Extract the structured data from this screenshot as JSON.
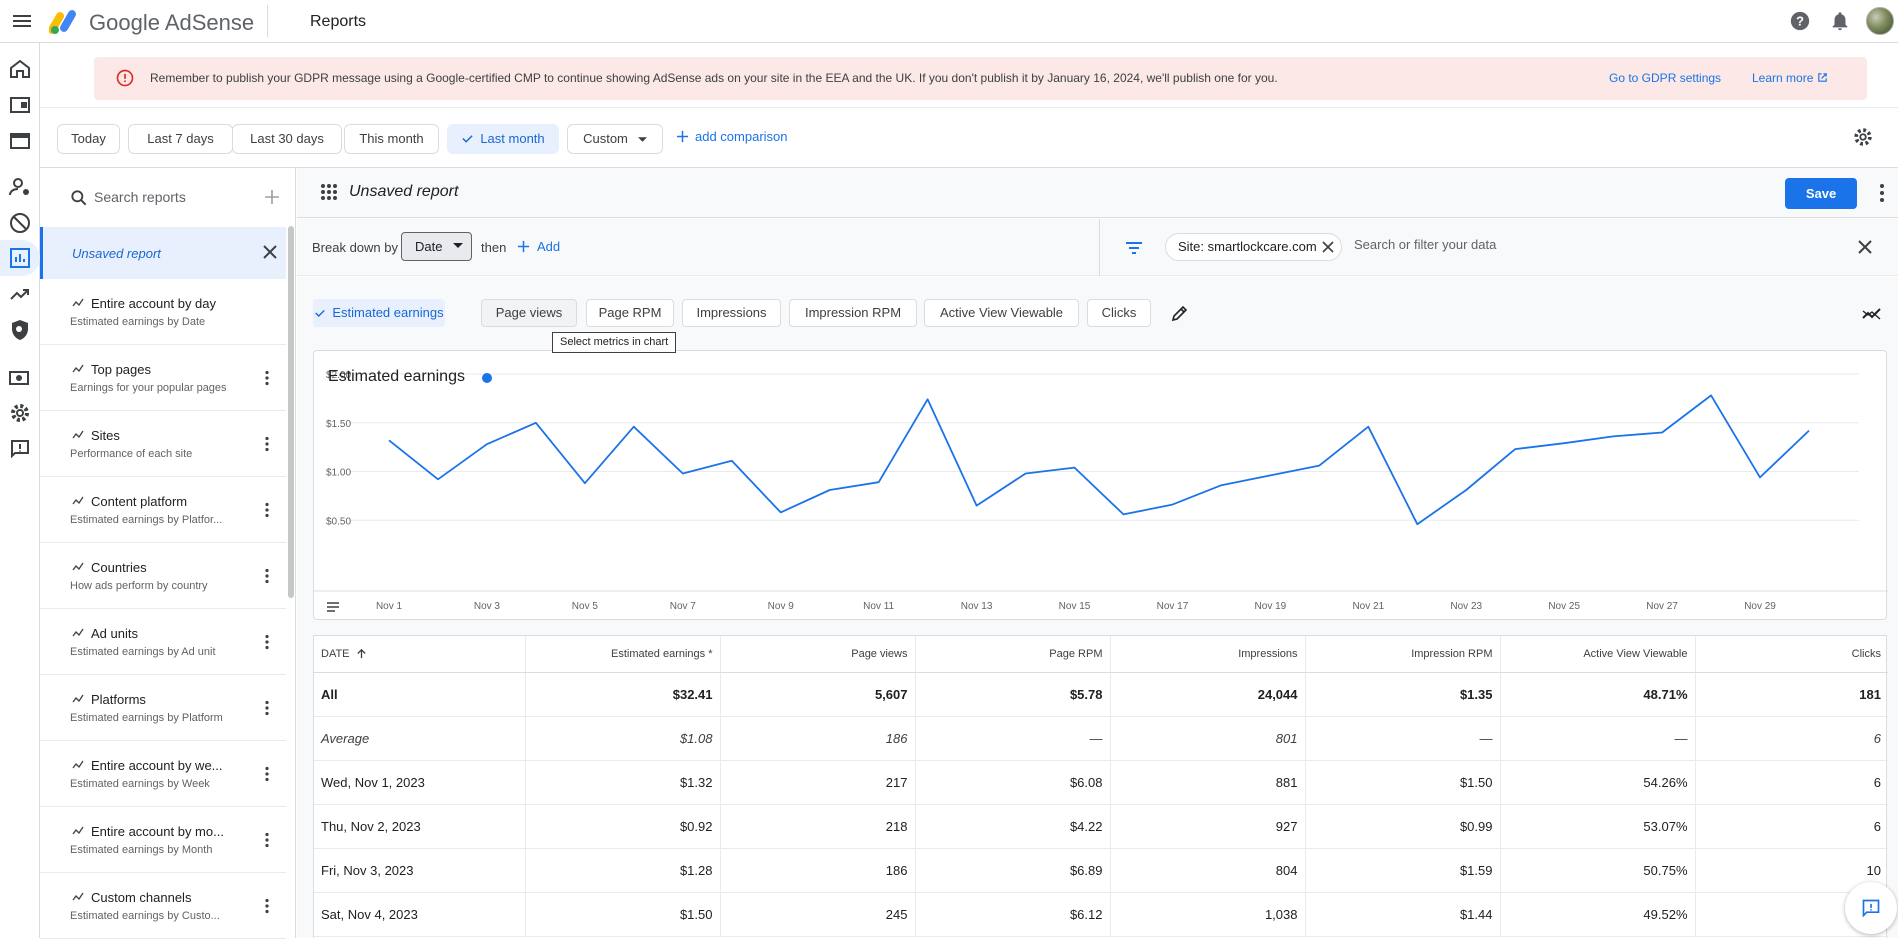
{
  "header": {
    "brand": "Google AdSense",
    "page_title": "Reports"
  },
  "gdpr_banner": {
    "message": "Remember to publish your GDPR message using a Google-certified CMP to continue showing AdSense ads on your site in the EEA and the UK. If you don't publish it by January 16, 2024, we'll publish one for you.",
    "link_settings": "Go to GDPR settings",
    "link_learn": "Learn more"
  },
  "date_ranges": [
    "Today",
    "Last 7 days",
    "Last 30 days",
    "This month",
    "Last month",
    "Custom"
  ],
  "date_range_selected": "Last month",
  "add_comparison": "add comparison",
  "report_list": {
    "search_placeholder": "Search reports",
    "unsaved_label": "Unsaved report",
    "items": [
      {
        "title": "Entire account by day",
        "subtitle": "Estimated earnings by Date",
        "has_more": false
      },
      {
        "title": "Top pages",
        "subtitle": "Earnings for your popular pages",
        "has_more": true
      },
      {
        "title": "Sites",
        "subtitle": "Performance of each site",
        "has_more": true
      },
      {
        "title": "Content platform",
        "subtitle": "Estimated earnings by Platfor...",
        "has_more": true
      },
      {
        "title": "Countries",
        "subtitle": "How ads perform by country",
        "has_more": true
      },
      {
        "title": "Ad units",
        "subtitle": "Estimated earnings by Ad unit",
        "has_more": true
      },
      {
        "title": "Platforms",
        "subtitle": "Estimated earnings by Platform",
        "has_more": true
      },
      {
        "title": "Entire account by we...",
        "subtitle": "Estimated earnings by Week",
        "has_more": true
      },
      {
        "title": "Entire account by mo...",
        "subtitle": "Estimated earnings by Month",
        "has_more": true
      },
      {
        "title": "Custom channels",
        "subtitle": "Estimated earnings by Custo...",
        "has_more": true
      }
    ]
  },
  "report": {
    "name": "Unsaved report",
    "save_label": "Save",
    "breakdown_label": "Break down by",
    "breakdown_value": "Date",
    "then_label": "then",
    "add_label": "Add",
    "filter_chip": "Site: smartlockcare.com",
    "filter_placeholder": "Search or filter your data"
  },
  "metrics": {
    "items": [
      "Estimated earnings",
      "Page views",
      "Page RPM",
      "Impressions",
      "Impression RPM",
      "Active View Viewable",
      "Clicks"
    ],
    "selected": "Estimated earnings",
    "tooltip": "Select metrics in chart"
  },
  "chart_data": {
    "type": "line",
    "title": "Estimated earnings",
    "x": [
      "Nov 1",
      "Nov 2",
      "Nov 3",
      "Nov 4",
      "Nov 5",
      "Nov 6",
      "Nov 7",
      "Nov 8",
      "Nov 9",
      "Nov 10",
      "Nov 11",
      "Nov 12",
      "Nov 13",
      "Nov 14",
      "Nov 15",
      "Nov 16",
      "Nov 17",
      "Nov 18",
      "Nov 19",
      "Nov 20",
      "Nov 21",
      "Nov 22",
      "Nov 23",
      "Nov 24",
      "Nov 25",
      "Nov 26",
      "Nov 27",
      "Nov 28",
      "Nov 29",
      "Nov 30"
    ],
    "x_tick_labels": [
      "Nov 1",
      "Nov 3",
      "Nov 5",
      "Nov 7",
      "Nov 9",
      "Nov 11",
      "Nov 13",
      "Nov 15",
      "Nov 17",
      "Nov 19",
      "Nov 21",
      "Nov 23",
      "Nov 25",
      "Nov 27",
      "Nov 29"
    ],
    "series": [
      {
        "values": [
          1.32,
          0.92,
          1.28,
          1.5,
          0.88,
          1.46,
          0.98,
          1.11,
          0.58,
          0.81,
          0.89,
          1.74,
          0.65,
          0.98,
          1.04,
          0.56,
          0.66,
          0.86,
          0.96,
          1.06,
          1.46,
          0.46,
          0.81,
          1.23,
          1.29,
          1.36,
          1.4,
          1.78,
          0.94,
          1.42
        ],
        "color": "#1a73e8"
      }
    ],
    "y_tick_labels": [
      "$0.50",
      "$1.00",
      "$1.50",
      "$2.00"
    ],
    "ylim": [
      0,
      2.0
    ],
    "grid": true
  },
  "table": {
    "columns": [
      "DATE",
      "Estimated earnings *",
      "Page views",
      "Page RPM",
      "Impressions",
      "Impression RPM",
      "Active View Viewable",
      "Clicks"
    ],
    "total": [
      "All",
      "$32.41",
      "5,607",
      "$5.78",
      "24,044",
      "$1.35",
      "48.71%",
      "181"
    ],
    "average": [
      "Average",
      "$1.08",
      "186",
      "—",
      "801",
      "—",
      "—",
      "6"
    ],
    "rows": [
      [
        "Wed, Nov 1, 2023",
        "$1.32",
        "217",
        "$6.08",
        "881",
        "$1.50",
        "54.26%",
        "6"
      ],
      [
        "Thu, Nov 2, 2023",
        "$0.92",
        "218",
        "$4.22",
        "927",
        "$0.99",
        "53.07%",
        "6"
      ],
      [
        "Fri, Nov 3, 2023",
        "$1.28",
        "186",
        "$6.89",
        "804",
        "$1.59",
        "50.75%",
        "10"
      ],
      [
        "Sat, Nov 4, 2023",
        "$1.50",
        "245",
        "$6.12",
        "1,038",
        "$1.44",
        "49.52%",
        ""
      ]
    ]
  },
  "colors": {
    "accent": "#1a73e8",
    "banner_bg": "#fce8e6",
    "error_red": "#d93025"
  }
}
